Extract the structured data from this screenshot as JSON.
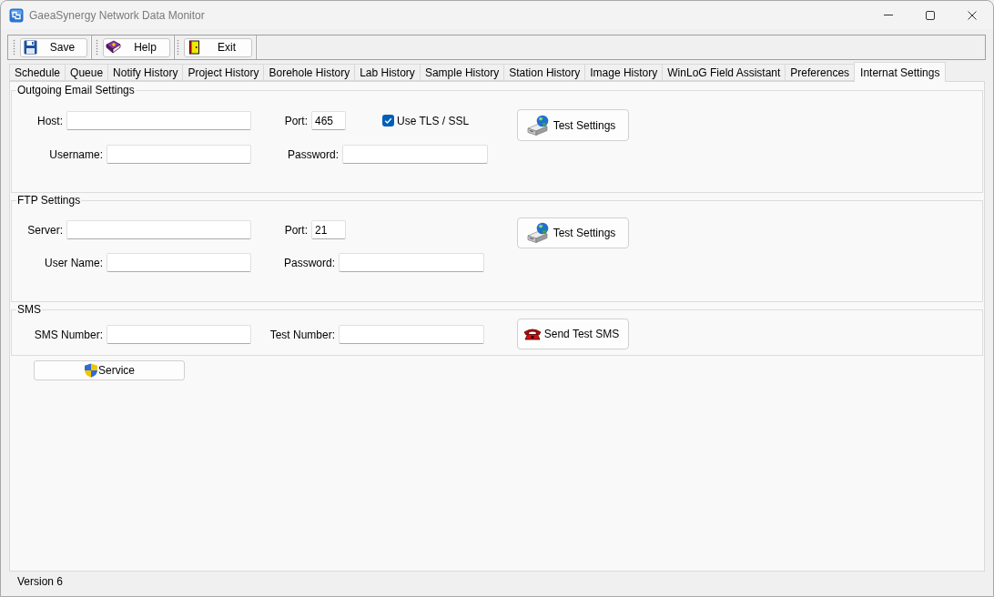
{
  "window": {
    "title": "GaeaSynergy Network Data Monitor"
  },
  "toolbar": [
    {
      "label": "Save"
    },
    {
      "label": "Help"
    },
    {
      "label": "Exit"
    }
  ],
  "tabs": [
    {
      "label": "Schedule",
      "selected": false
    },
    {
      "label": "Queue",
      "selected": false
    },
    {
      "label": "Notify History",
      "selected": false
    },
    {
      "label": "Project History",
      "selected": false
    },
    {
      "label": "Borehole History",
      "selected": false
    },
    {
      "label": "Lab History",
      "selected": false
    },
    {
      "label": "Sample History",
      "selected": false
    },
    {
      "label": "Station History",
      "selected": false
    },
    {
      "label": "Image History",
      "selected": false
    },
    {
      "label": "WinLoG Field Assistant",
      "selected": false
    },
    {
      "label": "Preferences",
      "selected": false
    },
    {
      "label": "Internat Settings",
      "selected": true
    }
  ],
  "groups": [
    {
      "title": "Outgoing Email Settings",
      "fields": [
        {
          "label": "Host:"
        },
        {
          "label": "Port:",
          "value": "465"
        },
        {
          "label": "Username:"
        },
        {
          "label": "Password:"
        }
      ],
      "checkbox": {
        "label": "Use TLS / SSL",
        "checked": true
      },
      "button": {
        "label": "Test Settings"
      }
    },
    {
      "title": "FTP Settings",
      "fields": [
        {
          "label": "Server:"
        },
        {
          "label": "Port:",
          "value": "21"
        },
        {
          "label": "User Name:"
        },
        {
          "label": "Password:"
        }
      ],
      "button": {
        "label": "Test Settings"
      }
    },
    {
      "title": "SMS",
      "fields": [
        {
          "label": "SMS Number:"
        },
        {
          "label": "Test Number:"
        }
      ],
      "button": {
        "label": "Send Test SMS"
      }
    }
  ],
  "service_button": {
    "label": "Service"
  },
  "status_bar": {
    "text": "Version 6"
  }
}
